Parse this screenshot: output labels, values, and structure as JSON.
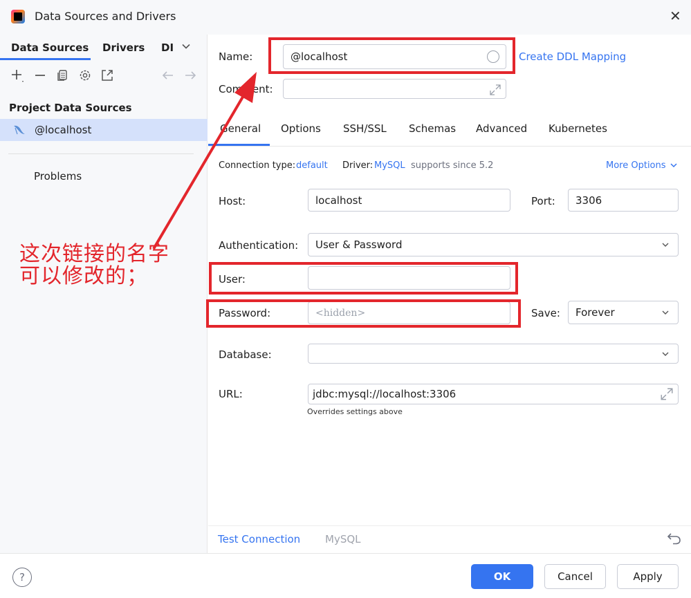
{
  "window": {
    "title": "Data Sources and Drivers",
    "close_glyph": "✕"
  },
  "left": {
    "tabs": [
      {
        "label": "Data Sources"
      },
      {
        "label": "Drivers"
      },
      {
        "label": "DI"
      }
    ],
    "section_title": "Project Data Sources",
    "data_sources": [
      {
        "label": "@localhost"
      }
    ],
    "problems_label": "Problems"
  },
  "form": {
    "name_label": "Name:",
    "name_value": "@localhost",
    "create_ddl_label": "Create DDL Mapping",
    "comment_label": "Comment:",
    "comment_value": "",
    "tabs": [
      {
        "label": "General"
      },
      {
        "label": "Options"
      },
      {
        "label": "SSH/SSL"
      },
      {
        "label": "Schemas"
      },
      {
        "label": "Advanced"
      },
      {
        "label": "Kubernetes"
      }
    ],
    "connection_type_label": "Connection type:",
    "connection_type_value": "default",
    "driver_label": "Driver:",
    "driver_value": "MySQL",
    "driver_note": "supports since 5.2",
    "more_options_label": "More Options",
    "host_label": "Host:",
    "host_value": "localhost",
    "port_label": "Port:",
    "port_value": "3306",
    "auth_label": "Authentication:",
    "auth_value": "User & Password",
    "user_label": "User:",
    "user_value": "",
    "password_label": "Password:",
    "password_placeholder": "<hidden>",
    "save_label": "Save:",
    "save_value": "Forever",
    "database_label": "Database:",
    "database_value": "",
    "url_label": "URL:",
    "url_value": "jdbc:mysql://localhost:3306",
    "url_hint": "Overrides settings above"
  },
  "bottom": {
    "test_connection_label": "Test Connection",
    "driver_name": "MySQL"
  },
  "footer": {
    "help_glyph": "?",
    "ok_label": "OK",
    "cancel_label": "Cancel",
    "apply_label": "Apply"
  },
  "annotation": {
    "line1": "这次链接的名字",
    "line2": "可以修改的；"
  },
  "colors": {
    "accent": "#3574f0",
    "annotation_red": "#e3262c",
    "selection": "#d5e1fb"
  }
}
